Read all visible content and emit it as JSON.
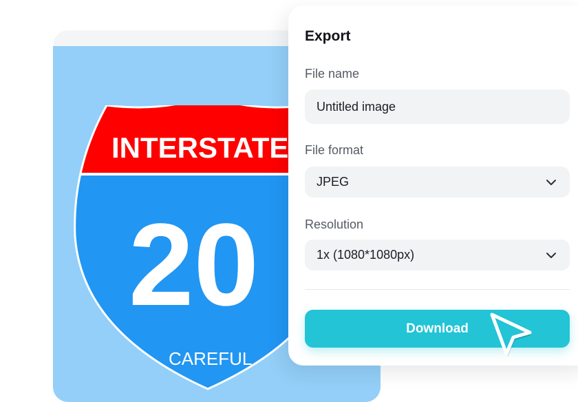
{
  "canvas": {
    "sign": {
      "top_text": "INTERSTATE",
      "number": "20",
      "bottom_text": "CAREFUL",
      "red_color": "#ff0000",
      "blue_color": "#2196f3",
      "background_color": "#93cff8"
    }
  },
  "export_panel": {
    "title": "Export",
    "file_name": {
      "label": "File name",
      "value": "Untitled image"
    },
    "file_format": {
      "label": "File format",
      "value": "JPEG"
    },
    "resolution": {
      "label": "Resolution",
      "value": "1x (1080*1080px)"
    },
    "download_label": "Download",
    "accent_color": "#22c4d6"
  }
}
